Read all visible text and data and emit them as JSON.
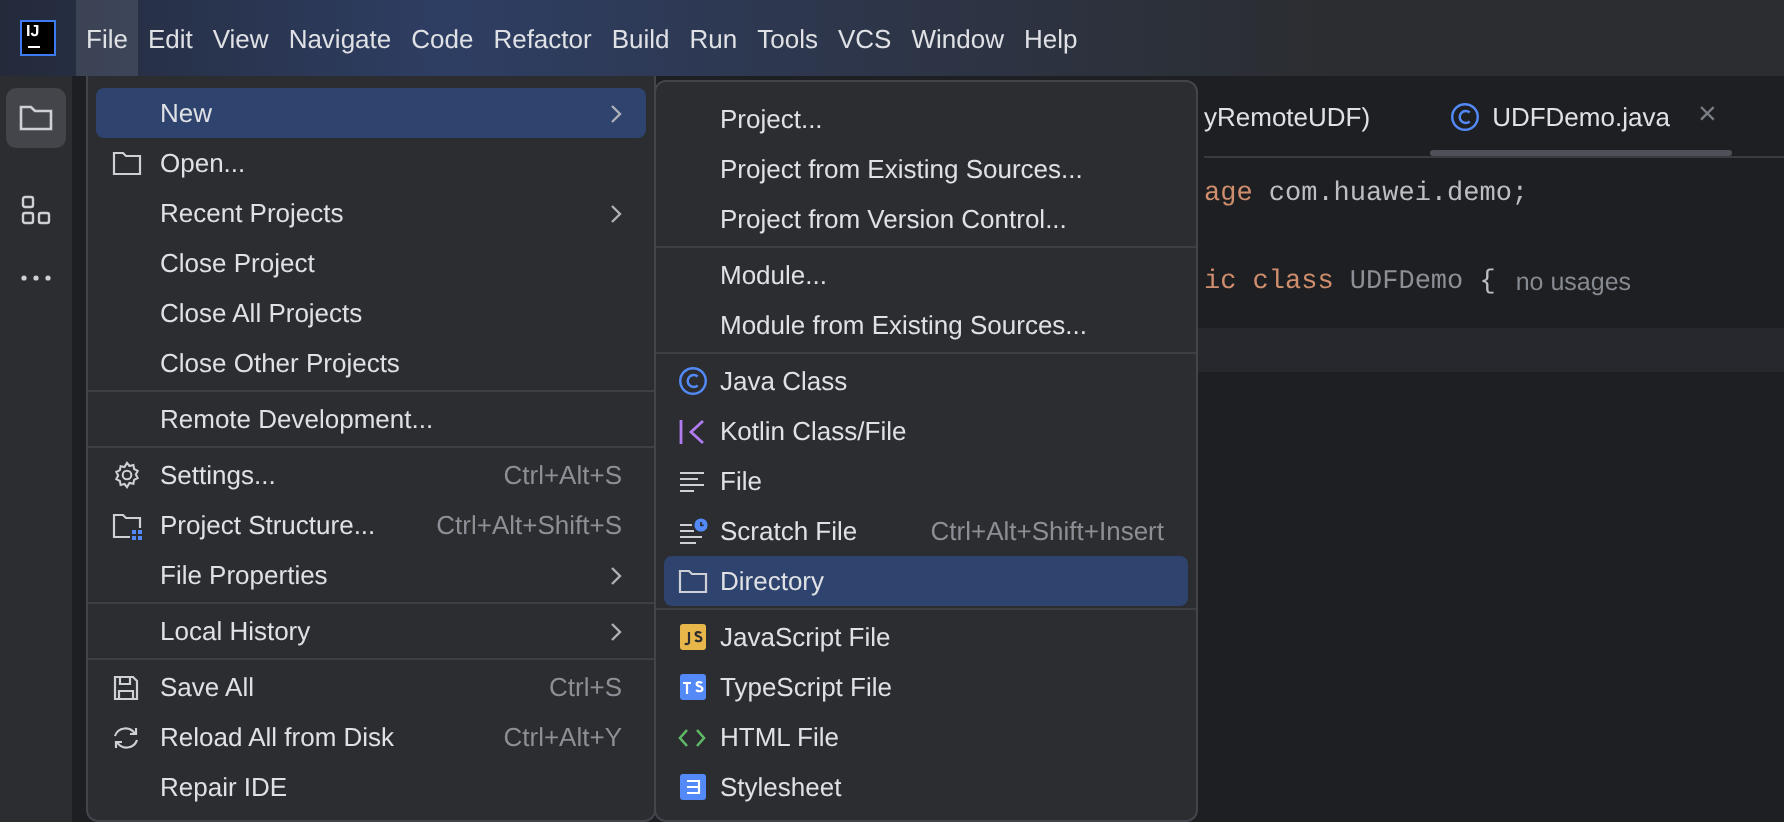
{
  "app_logo": "IJ",
  "menu_bar": [
    {
      "label": "File",
      "selected": true
    },
    {
      "label": "Edit",
      "selected": false
    },
    {
      "label": "View",
      "selected": false
    },
    {
      "label": "Navigate",
      "selected": false
    },
    {
      "label": "Code",
      "selected": false
    },
    {
      "label": "Refactor",
      "selected": false
    },
    {
      "label": "Build",
      "selected": false
    },
    {
      "label": "Run",
      "selected": false
    },
    {
      "label": "Tools",
      "selected": false
    },
    {
      "label": "VCS",
      "selected": false
    },
    {
      "label": "Window",
      "selected": false
    },
    {
      "label": "Help",
      "selected": false
    }
  ],
  "tool_window_bar": [
    {
      "selected": true
    },
    {
      "selected": false
    },
    {
      "selected": false
    }
  ],
  "editor": {
    "tabs": [
      {
        "kind": "plain",
        "label": "yRemoteUDF)",
        "selected": false
      },
      {
        "kind": "java",
        "label": "UDFDemo.java",
        "selected": true,
        "close": "×"
      }
    ],
    "lines": [
      {
        "tokens": [
          {
            "text": "age ",
            "kind": "keyword"
          },
          {
            "text": "com.huawei.demo;",
            "kind": "plain"
          }
        ]
      },
      {
        "tokens": [
          {
            "text": "ic class ",
            "kind": "keyword"
          },
          {
            "text": "UDFDemo ",
            "kind": "unused"
          },
          {
            "text": "{",
            "kind": "plain"
          },
          {
            "text": "no usages",
            "kind": "hint"
          }
        ]
      }
    ]
  },
  "file_menu": {
    "items": [
      {
        "kind": "plain",
        "label": "New",
        "submenu": true,
        "selected": true
      },
      {
        "kind": "folder",
        "label": "Open...",
        "submenu": false,
        "selected": false
      },
      {
        "kind": "plain",
        "label": "Recent Projects",
        "submenu": true,
        "selected": false
      },
      {
        "kind": "plain",
        "label": "Close Project",
        "submenu": false,
        "selected": false
      },
      {
        "kind": "plain",
        "label": "Close All Projects",
        "submenu": false,
        "selected": false
      },
      {
        "kind": "plain",
        "label": "Close Other Projects",
        "submenu": false,
        "selected": false
      },
      {
        "kind": "separator"
      },
      {
        "kind": "plain",
        "label": "Remote Development...",
        "submenu": false,
        "selected": false
      },
      {
        "kind": "separator"
      },
      {
        "kind": "gear",
        "label": "Settings...",
        "shortcut": "Ctrl+Alt+S",
        "submenu": false,
        "selected": false
      },
      {
        "kind": "structure",
        "label": "Project Structure...",
        "shortcut": "Ctrl+Alt+Shift+S",
        "submenu": false,
        "selected": false
      },
      {
        "kind": "plain",
        "label": "File Properties",
        "submenu": true,
        "selected": false
      },
      {
        "kind": "separator"
      },
      {
        "kind": "plain",
        "label": "Local History",
        "submenu": true,
        "selected": false
      },
      {
        "kind": "separator"
      },
      {
        "kind": "save",
        "label": "Save All",
        "shortcut": "Ctrl+S",
        "submenu": false,
        "selected": false
      },
      {
        "kind": "reload",
        "label": "Reload All from Disk",
        "shortcut": "Ctrl+Alt+Y",
        "submenu": false,
        "selected": false
      },
      {
        "kind": "plain",
        "label": "Repair IDE",
        "submenu": false,
        "selected": false
      }
    ]
  },
  "new_submenu": {
    "items": [
      {
        "kind": "plain",
        "label": "Project...",
        "selected": false
      },
      {
        "kind": "plain",
        "label": "Project from Existing Sources...",
        "selected": false
      },
      {
        "kind": "plain",
        "label": "Project from Version Control...",
        "selected": false
      },
      {
        "kind": "separator"
      },
      {
        "kind": "plain",
        "label": "Module...",
        "selected": false
      },
      {
        "kind": "plain",
        "label": "Module from Existing Sources...",
        "selected": false
      },
      {
        "kind": "separator"
      },
      {
        "kind": "java",
        "label": "Java Class",
        "selected": false
      },
      {
        "kind": "kotlin",
        "label": "Kotlin Class/File",
        "selected": false
      },
      {
        "kind": "file",
        "label": "File",
        "selected": false
      },
      {
        "kind": "scratch",
        "label": "Scratch File",
        "shortcut": "Ctrl+Alt+Shift+Insert",
        "selected": false
      },
      {
        "kind": "folder",
        "label": "Directory",
        "selected": true
      },
      {
        "kind": "separator"
      },
      {
        "kind": "js",
        "label": "JavaScript File",
        "selected": false
      },
      {
        "kind": "ts",
        "label": "TypeScript File",
        "selected": false
      },
      {
        "kind": "html",
        "label": "HTML File",
        "selected": false
      },
      {
        "kind": "css",
        "label": "Stylesheet",
        "selected": false
      }
    ]
  }
}
